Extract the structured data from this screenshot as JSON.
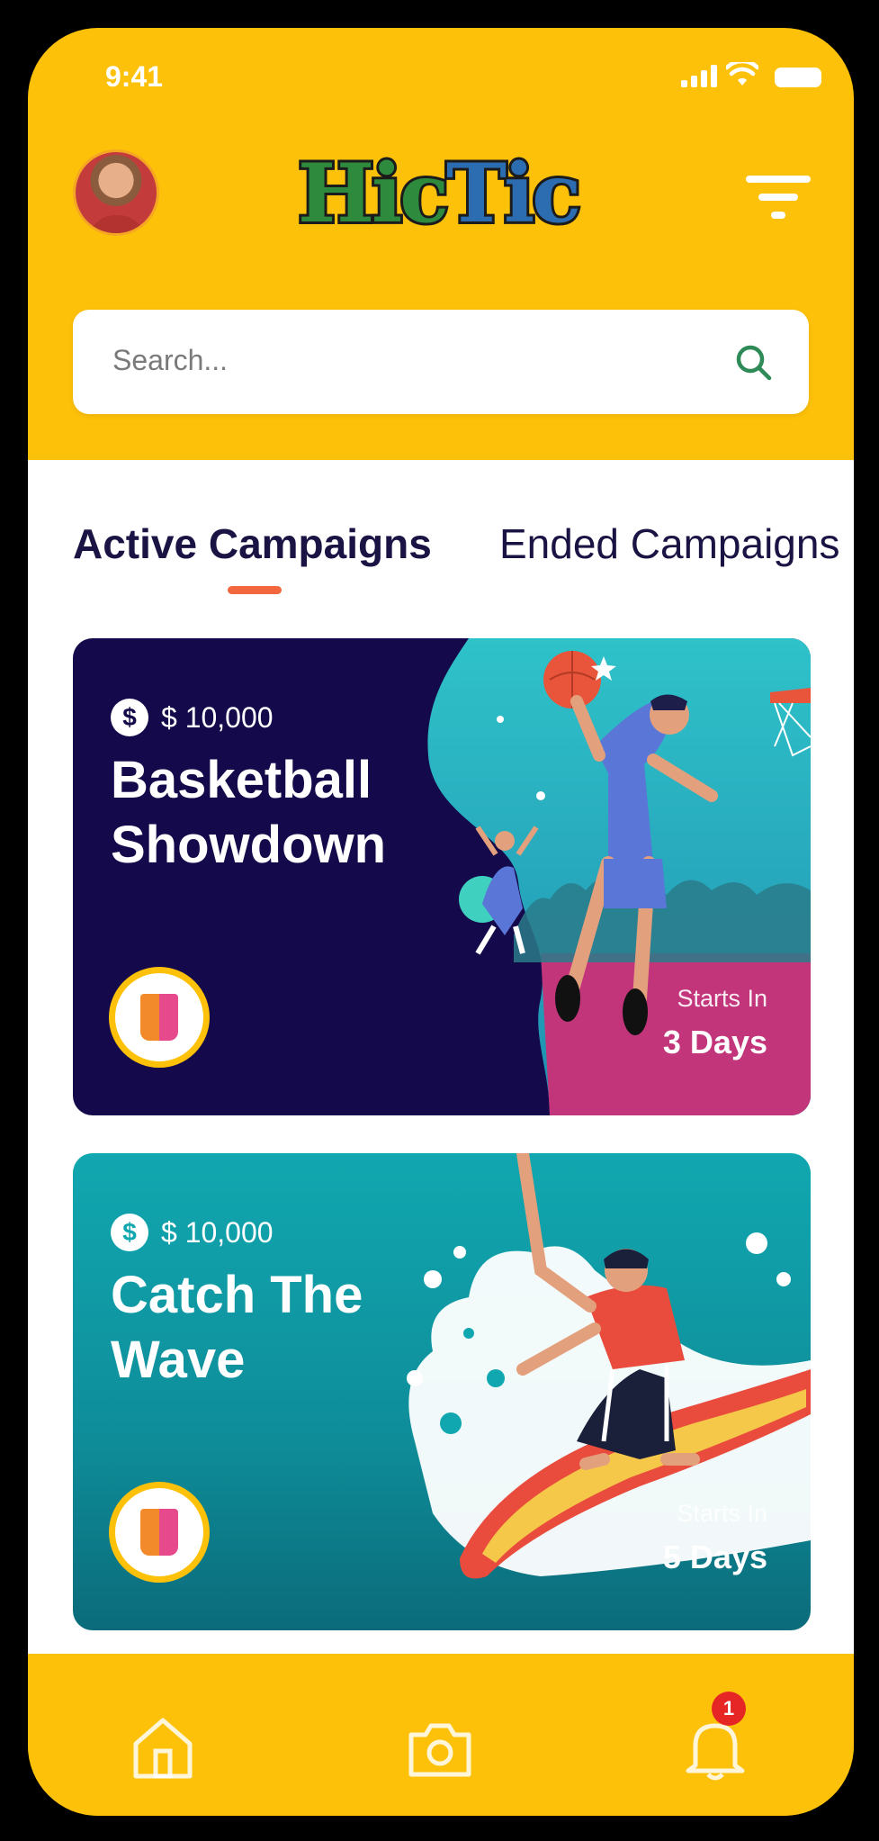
{
  "status_bar": {
    "time": "9:41"
  },
  "header": {
    "logo_part1": "Hic",
    "logo_part2": "Tic"
  },
  "search": {
    "placeholder": "Search..."
  },
  "tabs": [
    {
      "label": "Active Campaigns",
      "active": true
    },
    {
      "label": "Ended Campaigns",
      "active": false
    }
  ],
  "campaigns": [
    {
      "prize": "$ 10,000",
      "title": "Basketball Showdown",
      "starts_label": "Starts In",
      "starts_value": "3 Days"
    },
    {
      "prize": "$ 10,000",
      "title": "Catch The Wave",
      "starts_label": "Starts In",
      "starts_value": "5 Days"
    }
  ],
  "bottom_nav": {
    "items": [
      "home-icon",
      "camera-icon",
      "bell-icon"
    ],
    "notification_count": "1"
  },
  "colors": {
    "primary": "#fdc10a",
    "dark_card": "#14094a",
    "teal_card": "#11a7b0",
    "accent": "#f2673d"
  }
}
